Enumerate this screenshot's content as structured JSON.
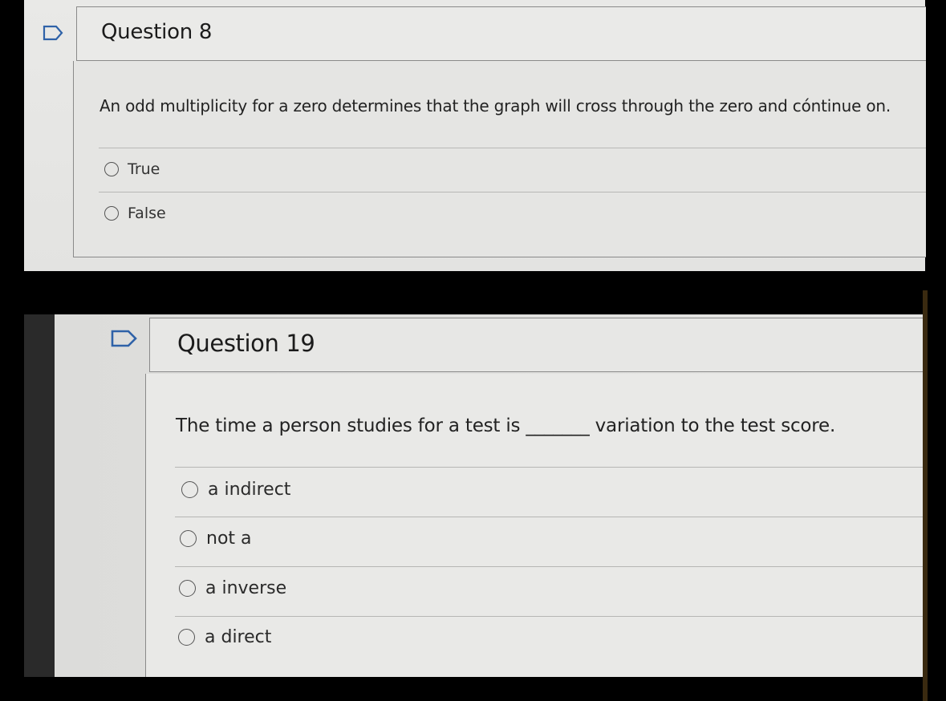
{
  "question8": {
    "title": "Question 8",
    "text": "An odd multiplicity for a zero determines that the graph will cross through the zero and cóntinue on.",
    "options": [
      {
        "label": "True"
      },
      {
        "label": "False"
      }
    ]
  },
  "question19": {
    "title": "Question 19",
    "text": "The time a person studies for a test is _______ variation to the test score.",
    "options": [
      {
        "label": "a indirect"
      },
      {
        "label": "not a"
      },
      {
        "label": "a inverse"
      },
      {
        "label": "a direct"
      }
    ]
  }
}
